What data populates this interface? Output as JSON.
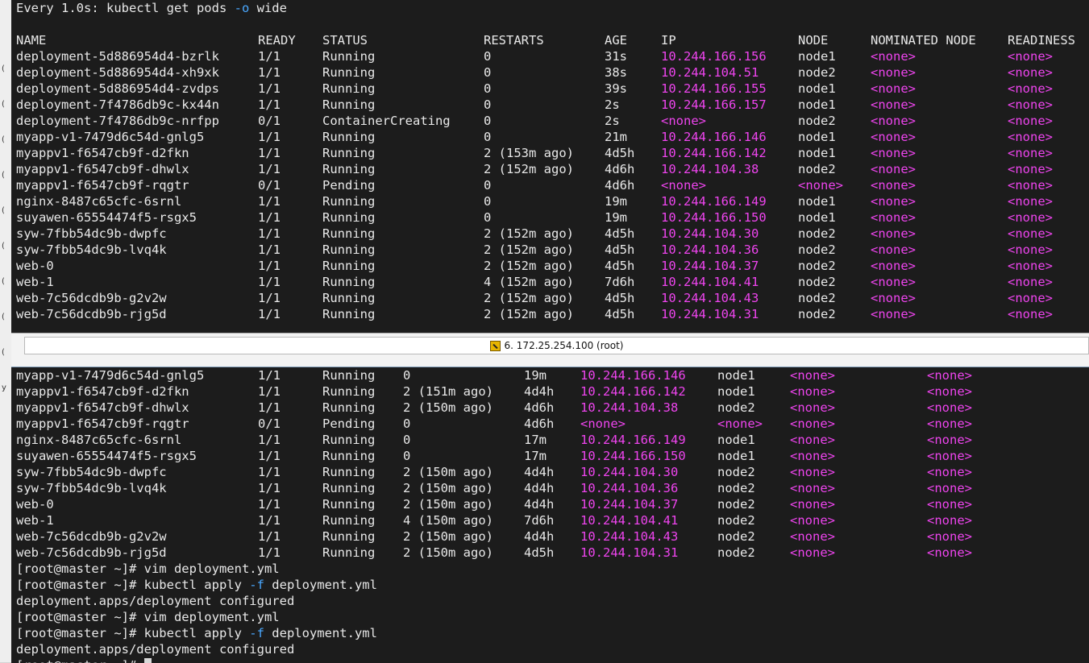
{
  "tab_title": "6. 172.25.254.100 (root)",
  "top": {
    "header": "Every 1.0s: kubectl get pods ",
    "header_flag": "-o",
    "header_tail": " wide",
    "columns": [
      "NAME",
      "READY",
      "STATUS",
      "RESTARTS",
      "AGE",
      "IP",
      "NODE",
      "NOMINATED NODE",
      "READINESS"
    ],
    "rows": [
      [
        "deployment-5d886954d4-bzrlk",
        "1/1",
        "Running",
        "0",
        "31s",
        "10.244.166.156",
        "node1",
        "<none>",
        "<none>"
      ],
      [
        "deployment-5d886954d4-xh9xk",
        "1/1",
        "Running",
        "0",
        "38s",
        "10.244.104.51",
        "node2",
        "<none>",
        "<none>"
      ],
      [
        "deployment-5d886954d4-zvdps",
        "1/1",
        "Running",
        "0",
        "39s",
        "10.244.166.155",
        "node1",
        "<none>",
        "<none>"
      ],
      [
        "deployment-7f4786db9c-kx44n",
        "1/1",
        "Running",
        "0",
        "2s",
        "10.244.166.157",
        "node1",
        "<none>",
        "<none>"
      ],
      [
        "deployment-7f4786db9c-nrfpp",
        "0/1",
        "ContainerCreating",
        "0",
        "2s",
        "<none>",
        "node2",
        "<none>",
        "<none>"
      ],
      [
        "myapp-v1-7479d6c54d-gnlg5",
        "1/1",
        "Running",
        "0",
        "21m",
        "10.244.166.146",
        "node1",
        "<none>",
        "<none>"
      ],
      [
        "myappv1-f6547cb9f-d2fkn",
        "1/1",
        "Running",
        "2 (153m ago)",
        "4d5h",
        "10.244.166.142",
        "node1",
        "<none>",
        "<none>"
      ],
      [
        "myappv1-f6547cb9f-dhwlx",
        "1/1",
        "Running",
        "2 (152m ago)",
        "4d6h",
        "10.244.104.38",
        "node2",
        "<none>",
        "<none>"
      ],
      [
        "myappv1-f6547cb9f-rqgtr",
        "0/1",
        "Pending",
        "0",
        "4d6h",
        "<none>",
        "<none>",
        "<none>",
        "<none>"
      ],
      [
        "nginx-8487c65cfc-6srnl",
        "1/1",
        "Running",
        "0",
        "19m",
        "10.244.166.149",
        "node1",
        "<none>",
        "<none>"
      ],
      [
        "suyawen-65554474f5-rsgx5",
        "1/1",
        "Running",
        "0",
        "19m",
        "10.244.166.150",
        "node1",
        "<none>",
        "<none>"
      ],
      [
        "syw-7fbb54dc9b-dwpfc",
        "1/1",
        "Running",
        "2 (152m ago)",
        "4d5h",
        "10.244.104.30",
        "node2",
        "<none>",
        "<none>"
      ],
      [
        "syw-7fbb54dc9b-lvq4k",
        "1/1",
        "Running",
        "2 (152m ago)",
        "4d5h",
        "10.244.104.36",
        "node2",
        "<none>",
        "<none>"
      ],
      [
        "web-0",
        "1/1",
        "Running",
        "2 (152m ago)",
        "4d5h",
        "10.244.104.37",
        "node2",
        "<none>",
        "<none>"
      ],
      [
        "web-1",
        "1/1",
        "Running",
        "4 (152m ago)",
        "7d6h",
        "10.244.104.41",
        "node2",
        "<none>",
        "<none>"
      ],
      [
        "web-7c56dcdb9b-g2v2w",
        "1/1",
        "Running",
        "2 (152m ago)",
        "4d5h",
        "10.244.104.43",
        "node2",
        "<none>",
        "<none>"
      ],
      [
        "web-7c56dcdb9b-rjg5d",
        "1/1",
        "Running",
        "2 (152m ago)",
        "4d5h",
        "10.244.104.31",
        "node2",
        "<none>",
        "<none>"
      ]
    ]
  },
  "bottom": {
    "rows": [
      [
        "myapp-v1-7479d6c54d-gnlg5",
        "1/1",
        "Running",
        "0",
        "19m",
        "10.244.166.146",
        "node1",
        "<none>",
        "<none>"
      ],
      [
        "myappv1-f6547cb9f-d2fkn",
        "1/1",
        "Running",
        "2 (151m ago)",
        "4d4h",
        "10.244.166.142",
        "node1",
        "<none>",
        "<none>"
      ],
      [
        "myappv1-f6547cb9f-dhwlx",
        "1/1",
        "Running",
        "2 (150m ago)",
        "4d6h",
        "10.244.104.38",
        "node2",
        "<none>",
        "<none>"
      ],
      [
        "myappv1-f6547cb9f-rqgtr",
        "0/1",
        "Pending",
        "0",
        "4d6h",
        "<none>",
        "<none>",
        "<none>",
        "<none>"
      ],
      [
        "nginx-8487c65cfc-6srnl",
        "1/1",
        "Running",
        "0",
        "17m",
        "10.244.166.149",
        "node1",
        "<none>",
        "<none>"
      ],
      [
        "suyawen-65554474f5-rsgx5",
        "1/1",
        "Running",
        "0",
        "17m",
        "10.244.166.150",
        "node1",
        "<none>",
        "<none>"
      ],
      [
        "syw-7fbb54dc9b-dwpfc",
        "1/1",
        "Running",
        "2 (150m ago)",
        "4d4h",
        "10.244.104.30",
        "node2",
        "<none>",
        "<none>"
      ],
      [
        "syw-7fbb54dc9b-lvq4k",
        "1/1",
        "Running",
        "2 (150m ago)",
        "4d4h",
        "10.244.104.36",
        "node2",
        "<none>",
        "<none>"
      ],
      [
        "web-0",
        "1/1",
        "Running",
        "2 (150m ago)",
        "4d4h",
        "10.244.104.37",
        "node2",
        "<none>",
        "<none>"
      ],
      [
        "web-1",
        "1/1",
        "Running",
        "4 (150m ago)",
        "7d6h",
        "10.244.104.41",
        "node2",
        "<none>",
        "<none>"
      ],
      [
        "web-7c56dcdb9b-g2v2w",
        "1/1",
        "Running",
        "2 (150m ago)",
        "4d4h",
        "10.244.104.43",
        "node2",
        "<none>",
        "<none>"
      ],
      [
        "web-7c56dcdb9b-rjg5d",
        "1/1",
        "Running",
        "2 (150m ago)",
        "4d5h",
        "10.244.104.31",
        "node2",
        "<none>",
        "<none>"
      ]
    ],
    "session": [
      {
        "prompt": "[root@master ~]# ",
        "cmd": "vim deployment.yml"
      },
      {
        "prompt": "[root@master ~]# ",
        "cmd": "kubectl apply ",
        "flag": "-f",
        "tail": " deployment.yml"
      },
      {
        "out": "deployment.apps/deployment configured"
      },
      {
        "prompt": "[root@master ~]# ",
        "cmd": "vim deployment.yml"
      },
      {
        "prompt": "[root@master ~]# ",
        "cmd": "kubectl apply ",
        "flag": "-f",
        "tail": " deployment.yml"
      },
      {
        "out": "deployment.apps/deployment configured"
      },
      {
        "prompt": "[root@master ~]# "
      }
    ]
  },
  "edge_glyphs": [
    "(",
    "(",
    "(",
    "(",
    "(",
    "(",
    "(",
    "(",
    "(",
    "y"
  ],
  "colors": {
    "ip": "#ee44ee",
    "flag": "#4aa8ff",
    "background": "#1c1c1c",
    "text": "#e8e8e8"
  },
  "icons": {
    "tab": "terminal-session-icon"
  }
}
